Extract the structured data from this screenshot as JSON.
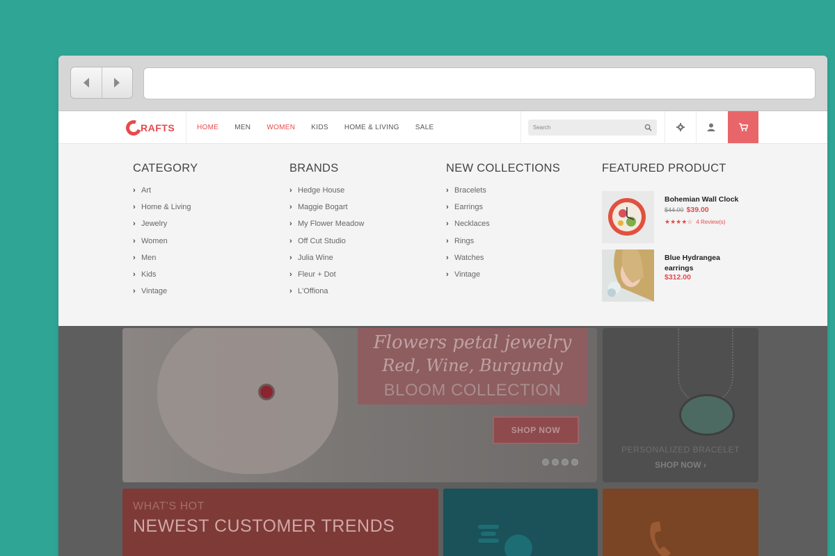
{
  "colors": {
    "accent": "#e8494b",
    "background": "#2fa596",
    "cart": "#e8666a"
  },
  "browser": {
    "url": ""
  },
  "header": {
    "logo_text": "RAFTS",
    "nav": [
      {
        "label": "HOME",
        "active": true
      },
      {
        "label": "MEN",
        "active": false
      },
      {
        "label": "WOMEN",
        "active": true
      },
      {
        "label": "KIDS",
        "active": false
      },
      {
        "label": "HOME & LIVING",
        "active": false
      },
      {
        "label": "SALE",
        "active": false
      }
    ],
    "search_placeholder": "Search",
    "icons": [
      "search-icon",
      "gear-icon",
      "user-icon",
      "cart-icon"
    ]
  },
  "mega": {
    "category": {
      "title": "CATEGORY",
      "items": [
        "Art",
        "Home & Living",
        "Jewelry",
        "Women",
        "Men",
        "Kids",
        "Vintage"
      ]
    },
    "brands": {
      "title": "BRANDS",
      "items": [
        "Hedge House",
        "Maggie Bogart",
        "My Flower Meadow",
        "Off Cut Studio",
        "Julia Wine",
        "Fleur + Dot",
        "L'Offiona"
      ]
    },
    "collections": {
      "title": "NEW COLLECTIONS",
      "items": [
        "Bracelets",
        "Earrings",
        "Necklaces",
        "Rings",
        "Watches",
        "Vintage"
      ]
    },
    "featured": {
      "title": "FEATURED PRODUCT",
      "products": [
        {
          "name": "Bohemian Wall Clock",
          "old_price": "$44.00",
          "price": "$39.00",
          "rating": 4,
          "reviews": "4 Review(s)"
        },
        {
          "name": "Blue Hydrangea earrings",
          "price": "$312.00"
        }
      ]
    }
  },
  "hero": {
    "line1": "Flowers petal jewelry",
    "line2": "Red, Wine, Burgundy",
    "line3": "BLOOM COLLECTION",
    "button": "SHOP NOW",
    "slides": 4
  },
  "side_card": {
    "title": "PERSONALIZED BRACELET",
    "link": "SHOP NOW ›"
  },
  "hot": {
    "small": "WHAT'S HOT",
    "big": "NEWEST CUSTOMER TRENDS"
  }
}
